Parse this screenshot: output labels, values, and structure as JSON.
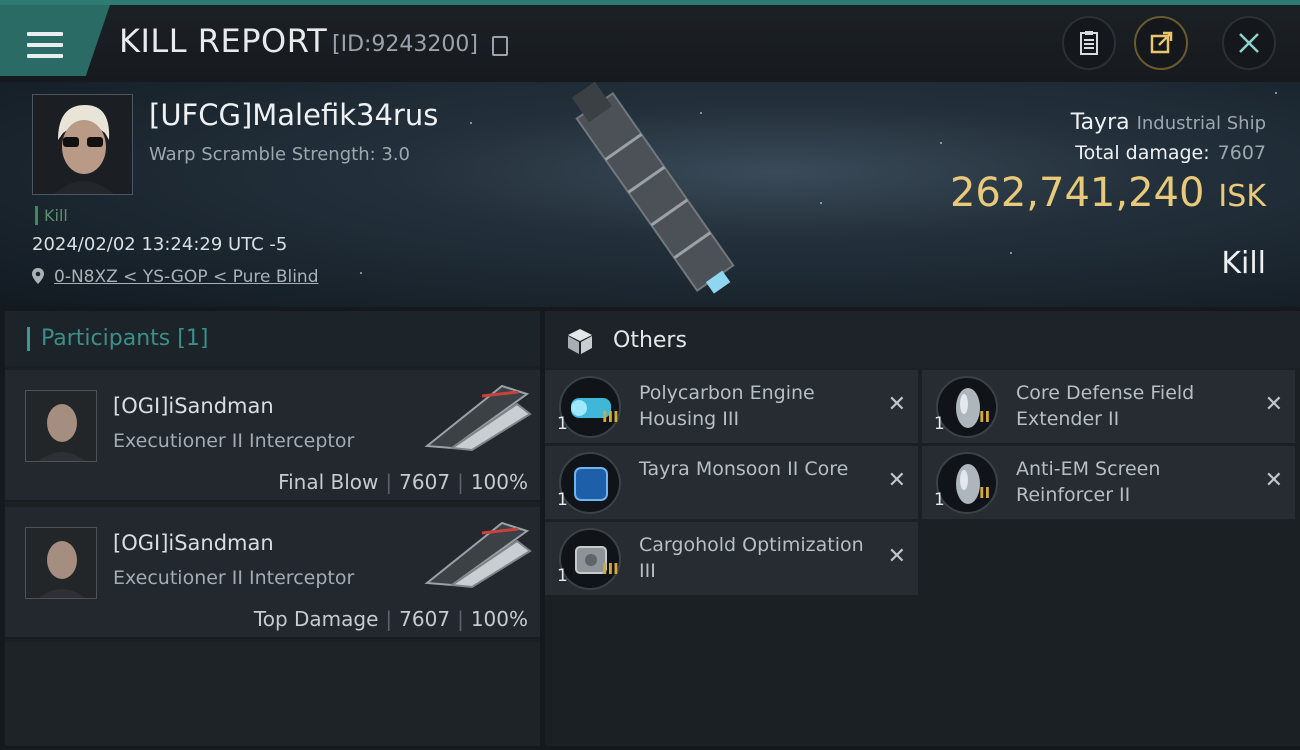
{
  "header": {
    "title": "KILL REPORT",
    "report_id": "[ID:9243200]"
  },
  "victim": {
    "name": "[UFCG]Malefik34rus",
    "warp_scramble": "Warp Scramble Strength: 3.0",
    "tag": "Kill",
    "datetime": "2024/02/02 13:24:29 UTC -5",
    "location": "0-N8XZ < YS-GOP < Pure Blind",
    "ship_name": "Tayra",
    "ship_class": "Industrial Ship",
    "total_damage_label": "Total damage:",
    "total_damage": "7607",
    "isk_value": "262,741,240",
    "isk_unit": "ISK",
    "result": "Kill"
  },
  "participants": {
    "title": "Participants",
    "count": "[1]",
    "items": [
      {
        "name": "[OGI]iSandman",
        "ship": "Executioner II Interceptor",
        "role": "Final Blow",
        "damage": "7607",
        "percent": "100%"
      },
      {
        "name": "[OGI]iSandman",
        "ship": "Executioner II Interceptor",
        "role": "Top Damage",
        "damage": "7607",
        "percent": "100%"
      }
    ]
  },
  "others": {
    "title": "Others",
    "items": [
      {
        "name": "Polycarbon Engine Housing III",
        "qty": "1",
        "tier": "III",
        "icon": "engine-module-icon"
      },
      {
        "name": "Core Defense Field Extender II",
        "qty": "1",
        "tier": "II",
        "icon": "shield-rig-icon"
      },
      {
        "name": "Tayra Monsoon II Core",
        "qty": "1",
        "tier": "",
        "icon": "core-module-icon"
      },
      {
        "name": "Anti-EM Screen Reinforcer II",
        "qty": "1",
        "tier": "II",
        "icon": "shield-rig-icon"
      },
      {
        "name": "Cargohold Optimization III",
        "qty": "1",
        "tier": "III",
        "icon": "cargo-module-icon"
      }
    ],
    "remove_glyph": "✕"
  },
  "colors": {
    "accent_teal": "#2e7b74",
    "isk_gold": "#e9c97a",
    "tier_gold": "#d4a93c"
  }
}
